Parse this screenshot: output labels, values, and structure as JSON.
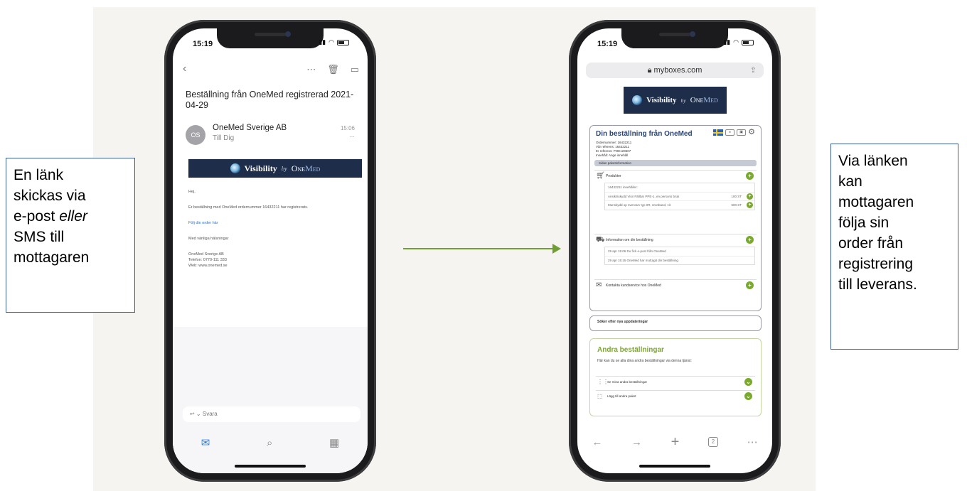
{
  "callouts": {
    "left": {
      "l1": "En länk",
      "l2": "skickas via",
      "l3a": "e-post ",
      "l3b": "eller",
      "l4": "SMS till",
      "l5": "mottagaren"
    },
    "right": {
      "l1": "Via länken",
      "l2": "kan",
      "l3": "mottagaren",
      "l4": "följa sin",
      "l5": "order från",
      "l6": "registrering",
      "l7": "till leverans."
    }
  },
  "colors": {
    "arrow": "#6f9f34",
    "callout_border": "#3b5da0",
    "brand_navy": "#1d2d4a",
    "accent_green": "#79a92d"
  },
  "mail_phone": {
    "time": "15:19",
    "subject": "Beställning från OneMed registrerad 2021-04-29",
    "avatar": "OS",
    "sender": "OneMed Sverige AB",
    "to": "Till Dig",
    "received": "15:06",
    "banner": {
      "word": "Visibility",
      "by": "by",
      "brand1": "One",
      "brand2": "Med"
    },
    "body": {
      "greeting": "Hej,",
      "line": "Er beställning med OneMed ordernummer 16432211 har registrerats.",
      "link": "Följ din order här",
      "regards": "Med vänliga hälsningar",
      "company": "OneMed Sverige AB",
      "phone": "Telefon: 0770-111 333",
      "web": "Web: www.onemed.se"
    },
    "reply_placeholder": "Svara"
  },
  "browser_phone": {
    "time": "15:19",
    "url": "myboxes.com",
    "banner": {
      "word": "Visibility",
      "by": "by",
      "brand1": "One",
      "brand2": "Med"
    },
    "order": {
      "title": "Din beställning från OneMed",
      "ordernumber": "Ordernummer: 16432211",
      "our_ref": "Vår referens: 16432211",
      "your_ref": "Er referens: POE123607",
      "content": "Innehåll: Ange innehåll",
      "section_pill": "Sidan paketinformation",
      "products_label": "Produkter",
      "product_order": "16432211 innehåller:",
      "product_1": "Ansiktsskydd Visir Fällbar PPE-1, en persons bruk",
      "product_1_qty": "100 ST",
      "product_2": "Munskydd op övervarv typ IIR, öronband, vit",
      "product_2_qty": "500 ST",
      "info_label": "Information om din beställning",
      "event_1_time": "29 apr 15:06",
      "event_1_text": "Du fick e-post från OneMed",
      "event_2_time": "29 apr 15:15",
      "event_2_text": "OneMed har mottagit din beställning",
      "contact_label": "Kontakta kundservice hos OneMed"
    },
    "updates": "Söker efter nya uppdateringar",
    "other": {
      "title": "Andra beställningar",
      "subtitle": "Här kan du se alla dina andra beställningar via denna tjänst:",
      "row_1": "Se mina andra beställningar",
      "row_2": "Lägg till andra paket"
    },
    "tab_count": "2"
  }
}
